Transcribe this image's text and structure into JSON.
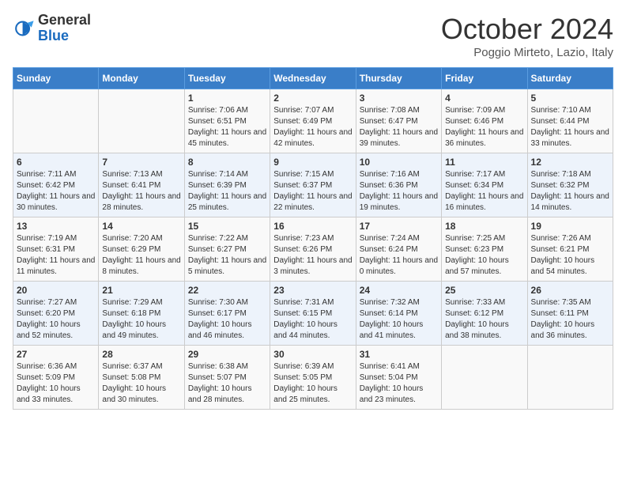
{
  "header": {
    "logo_general": "General",
    "logo_blue": "Blue",
    "month_title": "October 2024",
    "subtitle": "Poggio Mirteto, Lazio, Italy"
  },
  "weekdays": [
    "Sunday",
    "Monday",
    "Tuesday",
    "Wednesday",
    "Thursday",
    "Friday",
    "Saturday"
  ],
  "weeks": [
    [
      {
        "day": "",
        "sunrise": "",
        "sunset": "",
        "daylight": ""
      },
      {
        "day": "",
        "sunrise": "",
        "sunset": "",
        "daylight": ""
      },
      {
        "day": "1",
        "sunrise": "Sunrise: 7:06 AM",
        "sunset": "Sunset: 6:51 PM",
        "daylight": "Daylight: 11 hours and 45 minutes."
      },
      {
        "day": "2",
        "sunrise": "Sunrise: 7:07 AM",
        "sunset": "Sunset: 6:49 PM",
        "daylight": "Daylight: 11 hours and 42 minutes."
      },
      {
        "day": "3",
        "sunrise": "Sunrise: 7:08 AM",
        "sunset": "Sunset: 6:47 PM",
        "daylight": "Daylight: 11 hours and 39 minutes."
      },
      {
        "day": "4",
        "sunrise": "Sunrise: 7:09 AM",
        "sunset": "Sunset: 6:46 PM",
        "daylight": "Daylight: 11 hours and 36 minutes."
      },
      {
        "day": "5",
        "sunrise": "Sunrise: 7:10 AM",
        "sunset": "Sunset: 6:44 PM",
        "daylight": "Daylight: 11 hours and 33 minutes."
      }
    ],
    [
      {
        "day": "6",
        "sunrise": "Sunrise: 7:11 AM",
        "sunset": "Sunset: 6:42 PM",
        "daylight": "Daylight: 11 hours and 30 minutes."
      },
      {
        "day": "7",
        "sunrise": "Sunrise: 7:13 AM",
        "sunset": "Sunset: 6:41 PM",
        "daylight": "Daylight: 11 hours and 28 minutes."
      },
      {
        "day": "8",
        "sunrise": "Sunrise: 7:14 AM",
        "sunset": "Sunset: 6:39 PM",
        "daylight": "Daylight: 11 hours and 25 minutes."
      },
      {
        "day": "9",
        "sunrise": "Sunrise: 7:15 AM",
        "sunset": "Sunset: 6:37 PM",
        "daylight": "Daylight: 11 hours and 22 minutes."
      },
      {
        "day": "10",
        "sunrise": "Sunrise: 7:16 AM",
        "sunset": "Sunset: 6:36 PM",
        "daylight": "Daylight: 11 hours and 19 minutes."
      },
      {
        "day": "11",
        "sunrise": "Sunrise: 7:17 AM",
        "sunset": "Sunset: 6:34 PM",
        "daylight": "Daylight: 11 hours and 16 minutes."
      },
      {
        "day": "12",
        "sunrise": "Sunrise: 7:18 AM",
        "sunset": "Sunset: 6:32 PM",
        "daylight": "Daylight: 11 hours and 14 minutes."
      }
    ],
    [
      {
        "day": "13",
        "sunrise": "Sunrise: 7:19 AM",
        "sunset": "Sunset: 6:31 PM",
        "daylight": "Daylight: 11 hours and 11 minutes."
      },
      {
        "day": "14",
        "sunrise": "Sunrise: 7:20 AM",
        "sunset": "Sunset: 6:29 PM",
        "daylight": "Daylight: 11 hours and 8 minutes."
      },
      {
        "day": "15",
        "sunrise": "Sunrise: 7:22 AM",
        "sunset": "Sunset: 6:27 PM",
        "daylight": "Daylight: 11 hours and 5 minutes."
      },
      {
        "day": "16",
        "sunrise": "Sunrise: 7:23 AM",
        "sunset": "Sunset: 6:26 PM",
        "daylight": "Daylight: 11 hours and 3 minutes."
      },
      {
        "day": "17",
        "sunrise": "Sunrise: 7:24 AM",
        "sunset": "Sunset: 6:24 PM",
        "daylight": "Daylight: 11 hours and 0 minutes."
      },
      {
        "day": "18",
        "sunrise": "Sunrise: 7:25 AM",
        "sunset": "Sunset: 6:23 PM",
        "daylight": "Daylight: 10 hours and 57 minutes."
      },
      {
        "day": "19",
        "sunrise": "Sunrise: 7:26 AM",
        "sunset": "Sunset: 6:21 PM",
        "daylight": "Daylight: 10 hours and 54 minutes."
      }
    ],
    [
      {
        "day": "20",
        "sunrise": "Sunrise: 7:27 AM",
        "sunset": "Sunset: 6:20 PM",
        "daylight": "Daylight: 10 hours and 52 minutes."
      },
      {
        "day": "21",
        "sunrise": "Sunrise: 7:29 AM",
        "sunset": "Sunset: 6:18 PM",
        "daylight": "Daylight: 10 hours and 49 minutes."
      },
      {
        "day": "22",
        "sunrise": "Sunrise: 7:30 AM",
        "sunset": "Sunset: 6:17 PM",
        "daylight": "Daylight: 10 hours and 46 minutes."
      },
      {
        "day": "23",
        "sunrise": "Sunrise: 7:31 AM",
        "sunset": "Sunset: 6:15 PM",
        "daylight": "Daylight: 10 hours and 44 minutes."
      },
      {
        "day": "24",
        "sunrise": "Sunrise: 7:32 AM",
        "sunset": "Sunset: 6:14 PM",
        "daylight": "Daylight: 10 hours and 41 minutes."
      },
      {
        "day": "25",
        "sunrise": "Sunrise: 7:33 AM",
        "sunset": "Sunset: 6:12 PM",
        "daylight": "Daylight: 10 hours and 38 minutes."
      },
      {
        "day": "26",
        "sunrise": "Sunrise: 7:35 AM",
        "sunset": "Sunset: 6:11 PM",
        "daylight": "Daylight: 10 hours and 36 minutes."
      }
    ],
    [
      {
        "day": "27",
        "sunrise": "Sunrise: 6:36 AM",
        "sunset": "Sunset: 5:09 PM",
        "daylight": "Daylight: 10 hours and 33 minutes."
      },
      {
        "day": "28",
        "sunrise": "Sunrise: 6:37 AM",
        "sunset": "Sunset: 5:08 PM",
        "daylight": "Daylight: 10 hours and 30 minutes."
      },
      {
        "day": "29",
        "sunrise": "Sunrise: 6:38 AM",
        "sunset": "Sunset: 5:07 PM",
        "daylight": "Daylight: 10 hours and 28 minutes."
      },
      {
        "day": "30",
        "sunrise": "Sunrise: 6:39 AM",
        "sunset": "Sunset: 5:05 PM",
        "daylight": "Daylight: 10 hours and 25 minutes."
      },
      {
        "day": "31",
        "sunrise": "Sunrise: 6:41 AM",
        "sunset": "Sunset: 5:04 PM",
        "daylight": "Daylight: 10 hours and 23 minutes."
      },
      {
        "day": "",
        "sunrise": "",
        "sunset": "",
        "daylight": ""
      },
      {
        "day": "",
        "sunrise": "",
        "sunset": "",
        "daylight": ""
      }
    ]
  ]
}
